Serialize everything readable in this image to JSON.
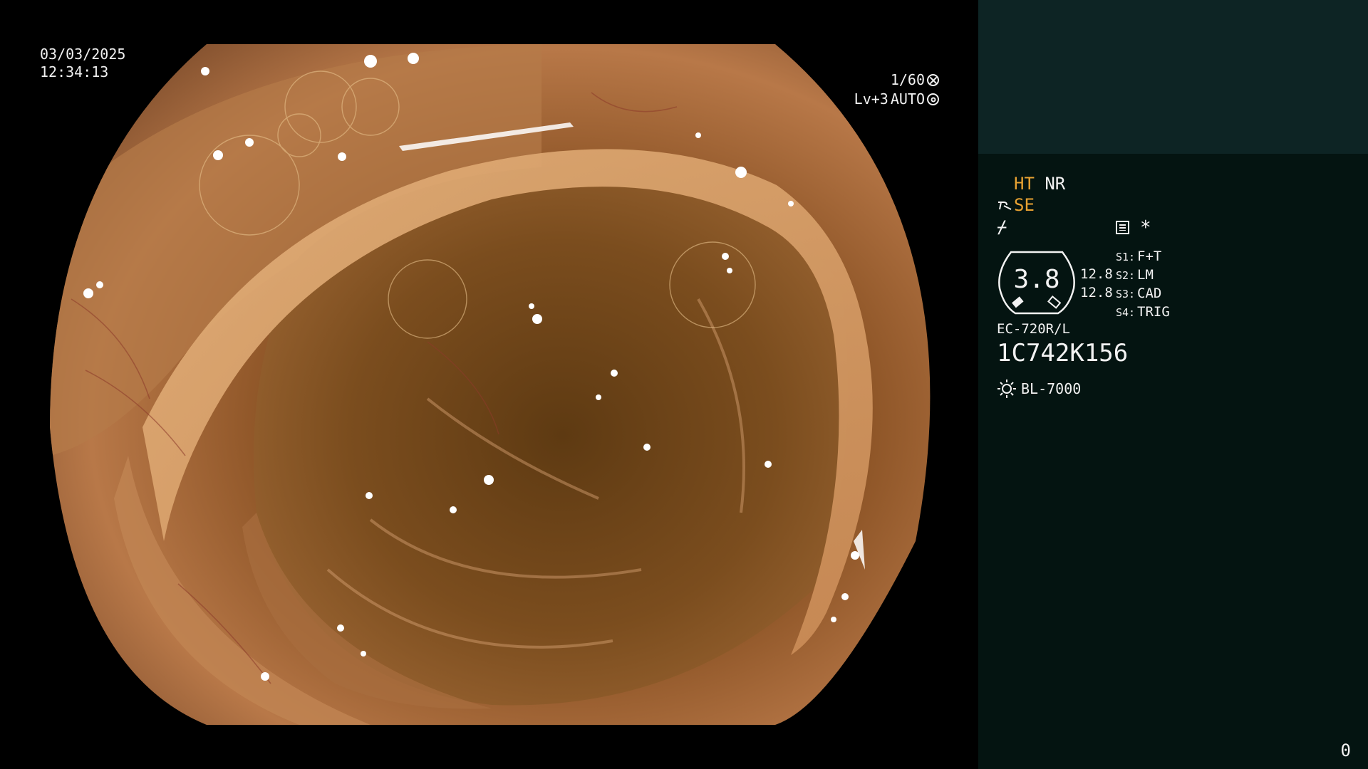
{
  "overlay": {
    "date": "03/03/2025",
    "time": "12:34:13",
    "shutter": "1/60",
    "level": "Lv+3",
    "iris": "AUTO"
  },
  "panel": {
    "ht": "HT",
    "nr": "NR",
    "se": "SE",
    "f_glyph": "⌿",
    "star": "*",
    "gauge_value": "3.8",
    "gauge_side_1": "12.8",
    "gauge_side_2": "12.8",
    "settings": [
      {
        "key": "S1:",
        "value": "F+T"
      },
      {
        "key": "S2:",
        "value": "LM"
      },
      {
        "key": "S3:",
        "value": "CAD"
      },
      {
        "key": "S4:",
        "value": "TRIG"
      }
    ],
    "scope_model": "EC-720R/L",
    "scope_serial": "1C742K156",
    "light_source": "BL-7000",
    "frame_count": "0"
  },
  "icons": [
    "shutter-icon",
    "iris-icon",
    "se-icon",
    "f-icon",
    "list-icon",
    "gauge-icon",
    "light-source-icon"
  ],
  "colors": {
    "accent_amber": "#e8a232",
    "panel_bg": "#041411",
    "panel_top_bg": "#0d2424"
  }
}
